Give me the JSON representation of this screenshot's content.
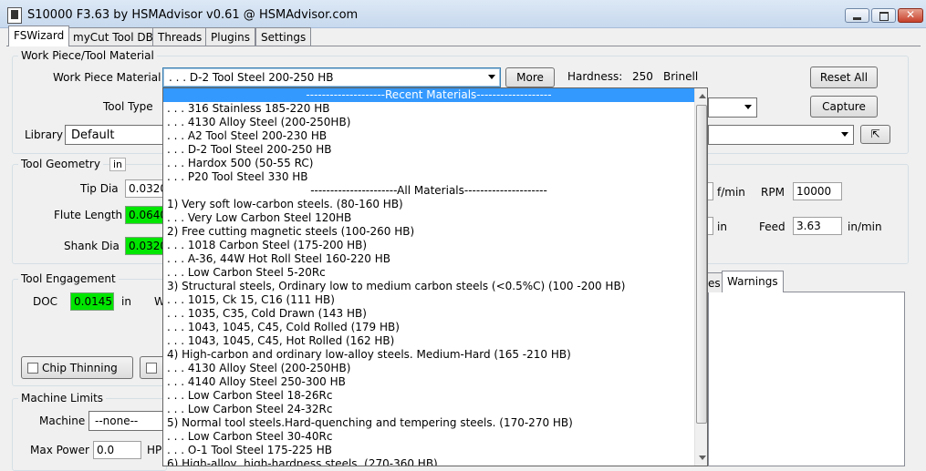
{
  "window": {
    "title": "S10000 F3.63 by HSMAdvisor v0.61 @ HSMAdvisor.com"
  },
  "tabs": [
    "FSWizard",
    "myCut Tool DB",
    "Threads",
    "Plugins",
    "Settings"
  ],
  "workpiece": {
    "group_label": "Work Piece/Tool Material",
    "material_label": "Work Piece Material",
    "material_value": ". . . D-2 Tool Steel 200-250 HB",
    "more_button": "More",
    "hardness_label": "Hardness:",
    "hardness_value": "250",
    "hardness_unit": "Brinell",
    "reset_button": "Reset All",
    "capture_button": "Capture",
    "tool_type_label": "Tool Type",
    "library_label": "Library",
    "library_value": "Default"
  },
  "geometry": {
    "group_label": "Tool Geometry",
    "unit": "in",
    "tip_dia_label": "Tip Dia",
    "tip_dia_value": "0.0320",
    "flute_length_label": "Flute Length",
    "flute_length_value": "0.0640",
    "shank_dia_label": "Shank Dia",
    "shank_dia_value": "0.0320"
  },
  "speeds": {
    "sfm_unit": "f/min",
    "rpm_label": "RPM",
    "rpm_value": "10000",
    "chip_unit": "in",
    "feed_label": "Feed",
    "feed_value": "3.63",
    "feed_unit": "in/min"
  },
  "engagement": {
    "group_label": "Tool Engagement",
    "doc_label": "DOC",
    "doc_value": "0.0145",
    "doc_unit": "in",
    "woc_label_partial": "W",
    "chip_thinning_label": "Chip Thinning"
  },
  "results_tabs": {
    "partial": "es",
    "warnings": "Warnings"
  },
  "machine": {
    "group_label": "Machine Limits",
    "machine_label": "Machine",
    "machine_value": "--none--",
    "max_power_label": "Max Power",
    "max_power_value": "0.0",
    "power_unit_partial": "HP"
  },
  "dropdown": {
    "items": [
      {
        "text": "--------------------Recent Materials-------------------",
        "style": "header-hl"
      },
      {
        "text": ". . . 316 Stainless 185-220 HB"
      },
      {
        "text": ". . . 4130 Alloy Steel (200-250HB)"
      },
      {
        "text": ". . . A2 Tool Steel 200-230 HB"
      },
      {
        "text": ". . . D-2 Tool Steel 200-250 HB"
      },
      {
        "text": ". . . Hardox 500 (50-55 RC)"
      },
      {
        "text": ". . . P20 Tool Steel 330 HB"
      },
      {
        "text": "----------------------All Materials---------------------",
        "style": "header"
      },
      {
        "text": "1) Very soft low-carbon steels. (80-160 HB)"
      },
      {
        "text": ". . . Very Low Carbon Steel 120HB"
      },
      {
        "text": "2) Free cutting magnetic steels (100-260 HB)"
      },
      {
        "text": ". . . 1018 Carbon Steel (175-200 HB)"
      },
      {
        "text": ". . . A-36, 44W Hot Roll Steel 160-220 HB"
      },
      {
        "text": ". . . Low Carbon Steel 5-20Rc"
      },
      {
        "text": "3) Structural steels, Ordinary low to medium carbon steels (<0.5%C) (100 -200 HB)"
      },
      {
        "text": ". . . 1015, Ck 15, C16  (111 HB)"
      },
      {
        "text": ". . . 1035, C35, Cold Drawn  (143 HB)"
      },
      {
        "text": ". . . 1043, 1045, C45, Cold Rolled  (179 HB)"
      },
      {
        "text": ". . . 1043, 1045, C45, Hot Rolled  (162 HB)"
      },
      {
        "text": "4) High-carbon and ordinary low-alloy steels. Medium-Hard (165 -210 HB)"
      },
      {
        "text": ". . . 4130 Alloy Steel (200-250HB)"
      },
      {
        "text": ". . . 4140 Alloy Steel 250-300 HB"
      },
      {
        "text": ". . . Low Carbon Steel 18-26Rc"
      },
      {
        "text": ". . . Low Carbon Steel 24-32Rc"
      },
      {
        "text": "5) Normal tool steels.Hard-quenching and tempering steels. (170-270 HB)"
      },
      {
        "text": ". . . Low Carbon Steel 30-40Rc"
      },
      {
        "text": ". . . O-1 Tool Steel 175-225 HB"
      },
      {
        "text": "6) High-alloy, high-hardness steels. (270-360 HB)"
      }
    ]
  }
}
